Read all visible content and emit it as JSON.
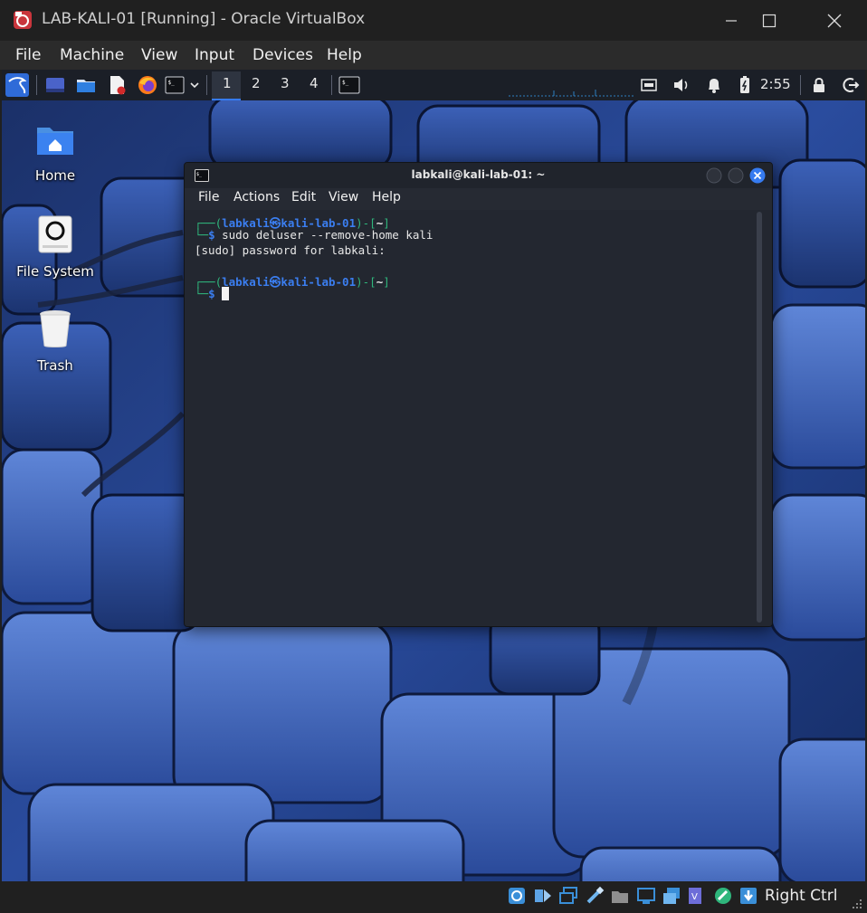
{
  "host_window": {
    "title": "LAB-KALI-01 [Running] - Oracle VirtualBox",
    "menu": [
      "File",
      "Machine",
      "View",
      "Input",
      "Devices",
      "Help"
    ],
    "host_key_label": "Right Ctrl"
  },
  "panel": {
    "workspaces": [
      "1",
      "2",
      "3",
      "4"
    ],
    "active_workspace": "1",
    "clock": "2:55"
  },
  "desktop_icons": [
    {
      "label": "Home",
      "icon": "home-folder-icon"
    },
    {
      "label": "File System",
      "icon": "drive-icon"
    },
    {
      "label": "Trash",
      "icon": "trash-icon"
    }
  ],
  "terminal": {
    "title": "labkali@kali-lab-01: ~",
    "menu": [
      "File",
      "Actions",
      "Edit",
      "View",
      "Help"
    ],
    "prompt_user": "labkali",
    "prompt_at": "㉿",
    "prompt_host": "kali-lab-01",
    "prompt_dir": "~",
    "command": "sudo deluser --remove-home kali",
    "output": "[sudo] password for labkali:"
  },
  "colors": {
    "prompt_green": "#2fb67c",
    "prompt_blue": "#3b7ef0",
    "close_button": "#367bf0"
  }
}
